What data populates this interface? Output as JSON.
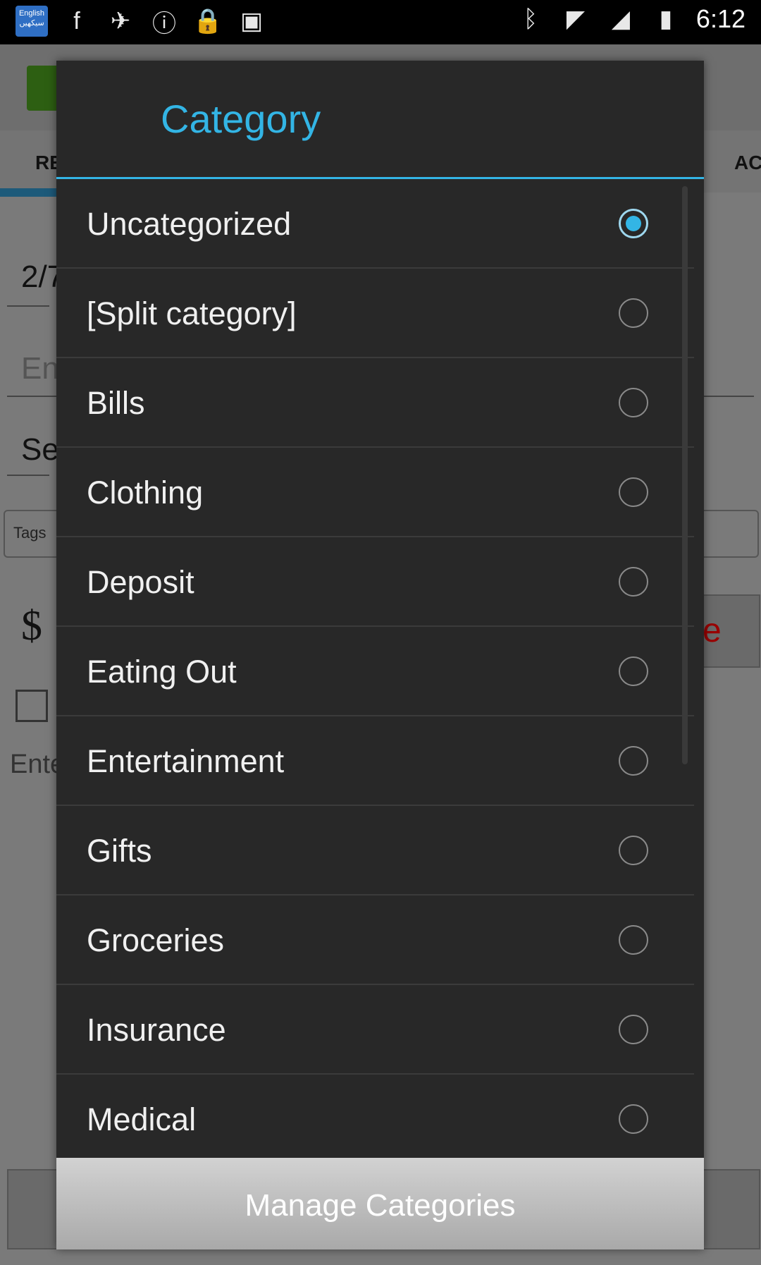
{
  "status_bar": {
    "language_badge": "English سیکھیں",
    "time": "6:12"
  },
  "background": {
    "tab_left": "RE",
    "tab_right": "AC",
    "date_fragment": "2/7",
    "entry_fragment": "En",
    "select_fragment": "Se",
    "tags_label": "Tags",
    "currency": "$",
    "red_fragment": "e",
    "enter_fragment": "Ente"
  },
  "dialog": {
    "title": "Category",
    "items": [
      {
        "label": "Uncategorized",
        "selected": true
      },
      {
        "label": "[Split category]",
        "selected": false
      },
      {
        "label": "Bills",
        "selected": false
      },
      {
        "label": "Clothing",
        "selected": false
      },
      {
        "label": "Deposit",
        "selected": false
      },
      {
        "label": "Eating Out",
        "selected": false
      },
      {
        "label": "Entertainment",
        "selected": false
      },
      {
        "label": "Gifts",
        "selected": false
      },
      {
        "label": "Groceries",
        "selected": false
      },
      {
        "label": "Insurance",
        "selected": false
      },
      {
        "label": "Medical",
        "selected": false
      }
    ],
    "footer_button": "Manage Categories",
    "accent_color": "#33b5e5"
  }
}
